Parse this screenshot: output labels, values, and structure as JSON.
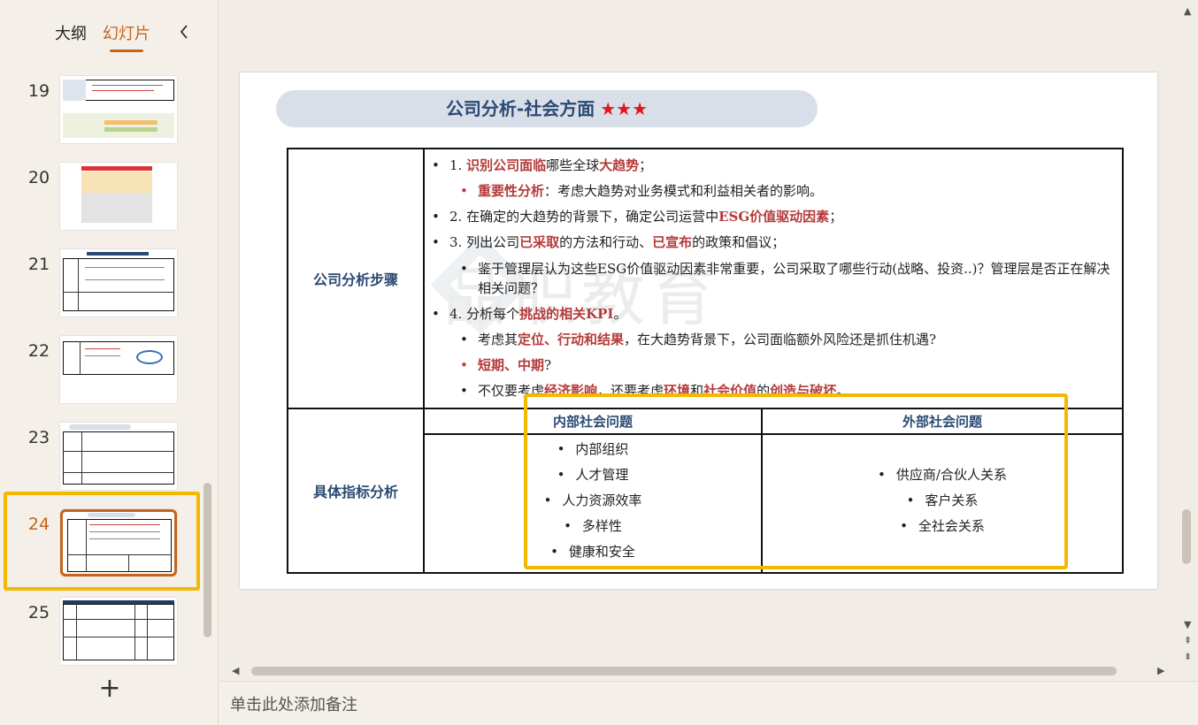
{
  "left_panel": {
    "tabs": [
      {
        "label": "大纲",
        "active": false
      },
      {
        "label": "幻灯片",
        "active": true
      }
    ],
    "slide_numbers": [
      "19",
      "20",
      "21",
      "22",
      "23",
      "24",
      "25"
    ],
    "selected_slide": "24",
    "add_icon": "plus-icon"
  },
  "slide": {
    "title": "公司分析-社会方面",
    "stars": "★★★",
    "watermark": "品职教育",
    "row1_label": "公司分析步骤",
    "row2_label": "具体指标分析",
    "steps": {
      "s1_num": "1.",
      "s1_hl1": "识别公司面临",
      "s1_t1": "哪些全球",
      "s1_hl2": "大趋势",
      "s1_end": "；",
      "s1a_hl": "重要性分析",
      "s1a_t": "：考虑大趋势对业务模式和利益相关者的影响。",
      "s2_num": "2.",
      "s2_t": "在确定的大趋势的背景下，确定公司运营中",
      "s2_hl": "ESG价值驱动因素",
      "s2_end": "；",
      "s3_num": "3.",
      "s3_t1": "列出公司",
      "s3_hl1": "已采取",
      "s3_t2": "的方法和行动、",
      "s3_hl2": "已宣布",
      "s3_t3": "的政策和倡议；",
      "s3a_t": "鉴于管理层认为这些ESG价值驱动因素非常重要，公司采取了哪些行动(战略、投资..)？管理层是否正在解决相关问题？",
      "s4_num": "4.",
      "s4_t": "分析每个",
      "s4_hl": "挑战的相关KPI",
      "s4_end": "。",
      "s4a_t1": "考虑其",
      "s4a_hl": "定位、行动和结果",
      "s4a_t2": "，在大趋势背景下，公司面临额外风险还是抓住机遇?",
      "s4b_hl": "短期、中期",
      "s4b_t": "?",
      "s4c_t1": "不仅要考虑",
      "s4c_hl1": "经济影响",
      "s4c_t2": "，还要考虑",
      "s4c_hl2": "环境",
      "s4c_t3": "和",
      "s4c_hl3": "社会价值",
      "s4c_t4": "的",
      "s4c_hl4": "创造与破坏",
      "s4c_end": "。"
    },
    "internal_header": "内部社会问题",
    "external_header": "外部社会问题",
    "internal_items": [
      "内部组织",
      "人才管理",
      "人力资源效率",
      "多样性",
      "健康和安全"
    ],
    "external_items": [
      "供应商/合伙人关系",
      "客户关系",
      "全社会关系"
    ]
  },
  "notes": {
    "placeholder": "单击此处添加备注"
  },
  "colors": {
    "accent": "#c5641a",
    "highlight_frame": "#f5b800",
    "title_text": "#2b4a73",
    "emphasis_red": "#b53a3a",
    "stars": "#e0161b"
  }
}
